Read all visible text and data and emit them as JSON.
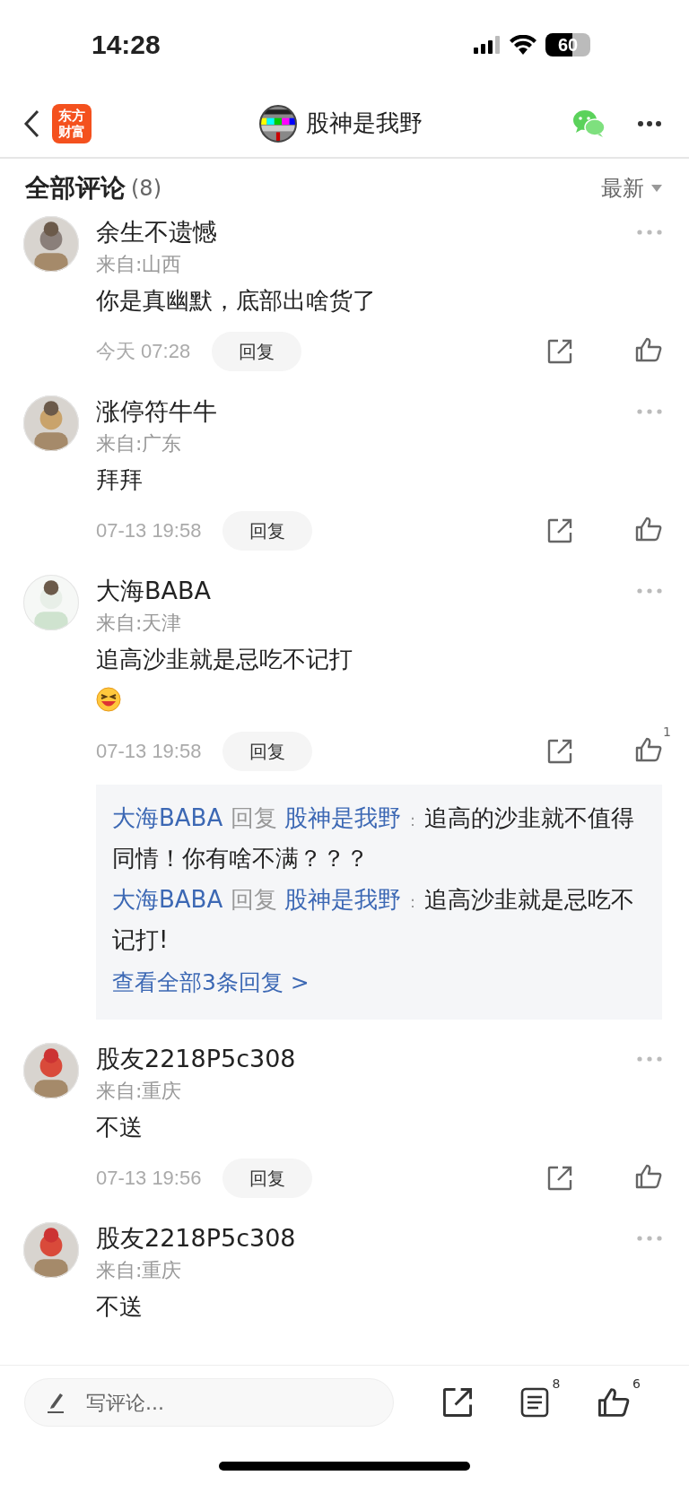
{
  "status_bar": {
    "time": "14:28",
    "battery": "60"
  },
  "header": {
    "logo_lines": [
      "东方",
      "财富"
    ],
    "title": "股神是我野"
  },
  "section": {
    "title": "全部评论",
    "count": "(8)",
    "sort": "最新"
  },
  "comments": [
    {
      "name": "余生不遗憾",
      "location": "来自:山西",
      "text": "你是真幽默，底部出啥货了",
      "time": "今天 07:28",
      "reply_button": "回复"
    },
    {
      "name": "涨停符牛牛",
      "location": "来自:广东",
      "text": "拜拜",
      "time": "07-13 19:58",
      "reply_button": "回复"
    },
    {
      "name": "大海BABA",
      "location": "来自:天津",
      "text": "追高沙韭就是忌吃不记打",
      "has_emoji": true,
      "time": "07-13 19:58",
      "reply_button": "回复",
      "likes": "1",
      "replies": [
        {
          "from": "大海BABA",
          "verb": "回复",
          "to": "股神是我野",
          "sep": "：",
          "text": "追高的沙韭就不值得同情！你有啥不满？？？"
        },
        {
          "from": "大海BABA",
          "verb": "回复",
          "to": "股神是我野",
          "sep": "：",
          "text": "追高沙韭就是忌吃不记打!"
        }
      ],
      "more_replies": "查看全部3条回复 >"
    },
    {
      "name": "股友2218P5c308",
      "location": "来自:重庆",
      "text": "不送",
      "time": "07-13 19:56",
      "reply_button": "回复"
    },
    {
      "name": "股友2218P5c308",
      "location": "来自:重庆",
      "text": "不送"
    }
  ],
  "bottom_bar": {
    "placeholder": "写评论...",
    "comments_count": "8",
    "likes_count": "6"
  }
}
